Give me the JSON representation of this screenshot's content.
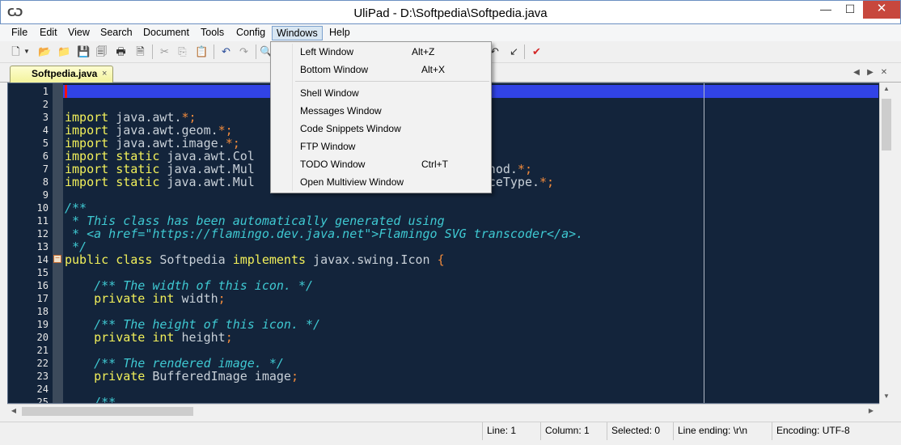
{
  "window": {
    "title": "UliPad - D:\\Softpedia\\Softpedia.java"
  },
  "menubar": {
    "items": [
      "File",
      "Edit",
      "View",
      "Search",
      "Document",
      "Tools",
      "Config",
      "Windows",
      "Help"
    ],
    "active": "Windows"
  },
  "tabs": {
    "active_label": "Softpedia.java",
    "close_glyph": "×"
  },
  "windows_menu": {
    "items": [
      {
        "label": "Left Window",
        "shortcut": "Alt+Z"
      },
      {
        "label": "Bottom Window",
        "shortcut": "Alt+X"
      },
      {
        "label": "Shell Window",
        "shortcut": ""
      },
      {
        "label": "Messages Window",
        "shortcut": ""
      },
      {
        "label": "Code Snippets Window",
        "shortcut": ""
      },
      {
        "label": "FTP Window",
        "shortcut": ""
      },
      {
        "label": "TODO Window",
        "shortcut": "Ctrl+T"
      },
      {
        "label": "Open Multiview Window",
        "shortcut": ""
      }
    ]
  },
  "editor": {
    "line_numbers": [
      "1",
      "2",
      "3",
      "4",
      "5",
      "6",
      "7",
      "8",
      "9",
      "10",
      "11",
      "12",
      "13",
      "14",
      "15",
      "16",
      "17",
      "18",
      "19",
      "20",
      "21",
      "22",
      "23",
      "24",
      "25"
    ],
    "lines": [
      "",
      "",
      "import java.awt.*;",
      "import java.awt.geom.*;",
      "import java.awt.image.*;",
      "import static java.awt.Col",
      "import static java.awt.Mul                                 hod.*;",
      "import static java.awt.Mul                                 ceType.*;",
      "",
      "/**",
      " * This class has been automatically generated using",
      " * <a href=\"https://flamingo.dev.java.net\">Flamingo SVG transcoder</a>.",
      " */",
      "public class Softpedia implements javax.swing.Icon {",
      "",
      "    /** The width of this icon. */",
      "    private int width;",
      "",
      "    /** The height of this icon. */",
      "    private int height;",
      "",
      "    /** The rendered image. */",
      "    private BufferedImage image;",
      "",
      "    /**"
    ]
  },
  "statusbar": {
    "line": "Line: 1",
    "column": "Column: 1",
    "selected": "Selected: 0",
    "line_ending": "Line ending: \\r\\n",
    "encoding": "Encoding: UTF-8"
  },
  "colors": {
    "editor_bg": "#13243b",
    "keyword": "#f2f05a",
    "comment": "#3fc9d2",
    "operator": "#f08a3c",
    "current_line": "#3143e6"
  }
}
